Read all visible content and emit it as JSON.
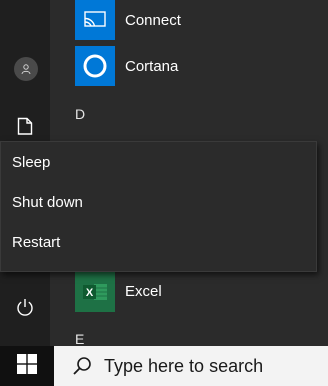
{
  "apps": [
    {
      "label": "Connect",
      "icon": "connect-icon",
      "tile_color": "#0078d7"
    },
    {
      "label": "Cortana",
      "icon": "cortana-icon",
      "tile_color": "#0078d7"
    }
  ],
  "section_letters": [
    "D",
    "E"
  ],
  "power_menu": {
    "items": [
      "Sleep",
      "Shut down",
      "Restart"
    ]
  },
  "excel": {
    "label": "Excel",
    "icon": "excel-icon",
    "tile_color": "#1e7145",
    "letter": "X"
  },
  "rail_icons": [
    "user-avatar-icon",
    "documents-icon",
    "power-icon"
  ],
  "taskbar": {
    "start_icon": "windows-logo-icon",
    "search_placeholder": "Type here to search"
  },
  "colors": {
    "accent": "#0078d7",
    "excel_green": "#1e7145",
    "menu_bg": "#2b2b2b",
    "rail_bg": "#1f1f1f",
    "taskbar_bg": "#101010"
  }
}
